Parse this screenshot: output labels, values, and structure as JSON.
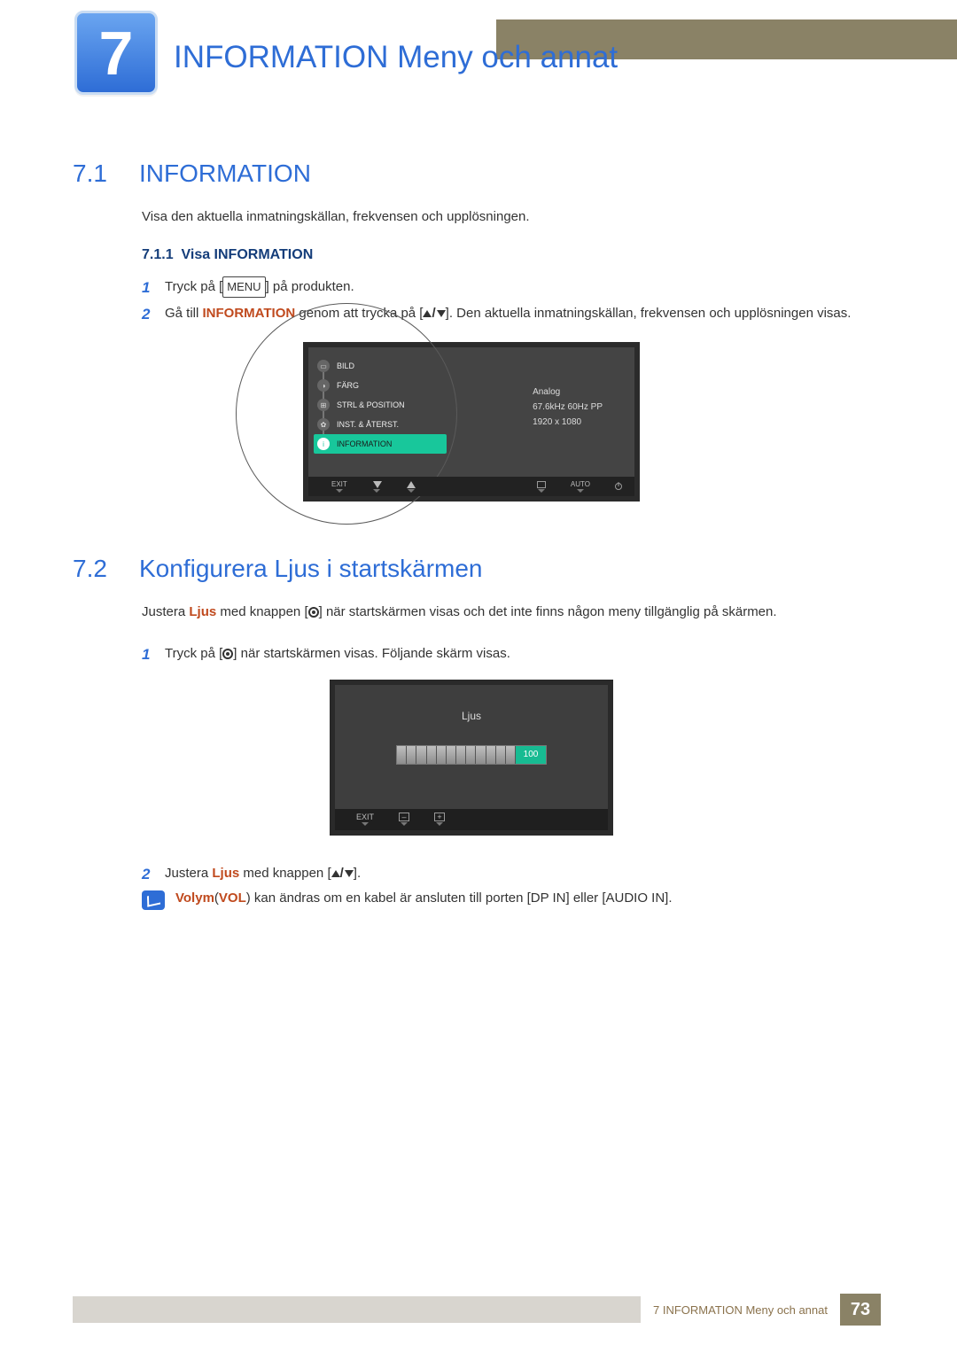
{
  "chapter": {
    "number": "7",
    "title": "INFORMATION Meny och annat"
  },
  "section_7_1": {
    "num": "7.1",
    "title": "INFORMATION",
    "intro": "Visa den aktuella inmatningskällan, frekvensen och upplösningen.",
    "sub": {
      "num": "7.1.1",
      "title": "Visa INFORMATION",
      "steps": {
        "s1_a": "Tryck på [",
        "s1_menu": "MENU",
        "s1_b": "] på produkten.",
        "s2_a": "Gå till ",
        "s2_hl": "INFORMATION",
        "s2_b": " genom att trycka på [",
        "s2_c": "]. Den aktuella inmatningskällan, frekvensen och upplösningen visas."
      }
    },
    "osd": {
      "menu": {
        "bild": "BILD",
        "farg": "FÄRG",
        "strl": "STRL & POSITION",
        "inst": "INST. & ÅTERST.",
        "info": "INFORMATION"
      },
      "panel": {
        "source": "Analog",
        "freq": "67.6kHz 60Hz PP",
        "res": "1920 x 1080"
      },
      "bottom": {
        "exit": "EXIT",
        "auto": "AUTO"
      }
    }
  },
  "section_7_2": {
    "num": "7.2",
    "title": "Konfigurera Ljus i startskärmen",
    "intro_a": "Justera ",
    "intro_hl": "Ljus",
    "intro_b": " med knappen [",
    "intro_c": "] när startskärmen visas och det inte finns någon meny tillgänglig på skärmen.",
    "step1_a": "Tryck på [",
    "step1_b": "] när startskärmen visas. Följande skärm visas.",
    "osd": {
      "title": "Ljus",
      "value": "100",
      "exit": "EXIT"
    },
    "step2_a": "Justera ",
    "step2_hl": "Ljus",
    "step2_b": " med knappen [",
    "step2_c": "].",
    "note_a": "Volym",
    "note_b": "(",
    "note_vol": "VOL",
    "note_c": ") kan ändras om en kabel är ansluten till porten [DP IN] eller [AUDIO IN]."
  },
  "footer": {
    "text": "7 INFORMATION Meny och annat",
    "page": "73"
  }
}
